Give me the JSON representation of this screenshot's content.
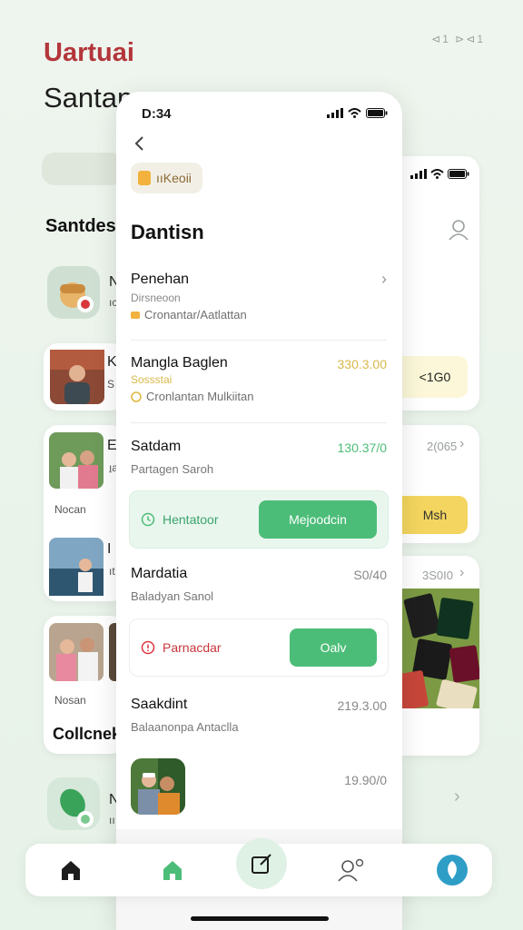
{
  "background": {
    "brand": "Uartuai",
    "title": "Santan",
    "top_icons": "⊲1 ⊳⊲1",
    "section_title": "Santdes",
    "list_letters": [
      "N",
      "K",
      "E",
      "I",
      "N"
    ],
    "list_subletters": [
      "ıc",
      "S",
      "ı̱a",
      "ıt",
      "ıı"
    ],
    "captions": [
      "Nocan",
      "Nosan"
    ],
    "collection_title": "Collcnek"
  },
  "right_stack": {
    "amount_box": "<1G0",
    "muted_1": "2(065",
    "button": "Msh",
    "muted_2": "3S0I0"
  },
  "phone": {
    "time": "D:34",
    "chip_label": "ııKeoii",
    "title": "Dantisn",
    "rows": [
      {
        "title": "Penehan",
        "sub": "Dirsneoon",
        "meta": "Cronantar/Aatlattan",
        "amount": ""
      },
      {
        "title": "Mangla Baglen",
        "sub": "Sossstai",
        "meta": "Cronlantan Mulkiitan",
        "amount": "330.3.00"
      },
      {
        "title": "Satdam",
        "sub": "Partagen Saroh",
        "meta": "",
        "amount": "130.37/0"
      },
      {
        "title": "Mardatia",
        "sub": "Baladyan Sanol",
        "meta": "",
        "amount": "S0/40"
      },
      {
        "title": "Saakdint",
        "sub": "Balaanonpa Antaclla",
        "meta": "",
        "amount": "219.3.00"
      },
      {
        "title": "",
        "sub": "",
        "meta": "",
        "amount": "19.90/0"
      }
    ],
    "action_green": {
      "label": "Hentatoor",
      "button": "Mejoodcin"
    },
    "action_red": {
      "label": "Parnacdar",
      "button": "Oalv"
    }
  },
  "colors": {
    "brand_red": "#b3363b",
    "accent_green": "#4cbd78",
    "accent_yellow": "#f3d55f",
    "amount_yellow": "#d9b84a",
    "amount_green": "#4cbd78",
    "alert_red": "#d9363e",
    "profile_blue": "#2f9ec6"
  },
  "icons": [
    "back-chevron-icon",
    "chip-doc-icon",
    "chevron-right-icon",
    "coin-icon",
    "clock-icon",
    "alert-icon",
    "home-icon",
    "compose-icon",
    "user-icon",
    "profile-circle-icon",
    "signal-icon",
    "wifi-icon",
    "battery-icon"
  ]
}
